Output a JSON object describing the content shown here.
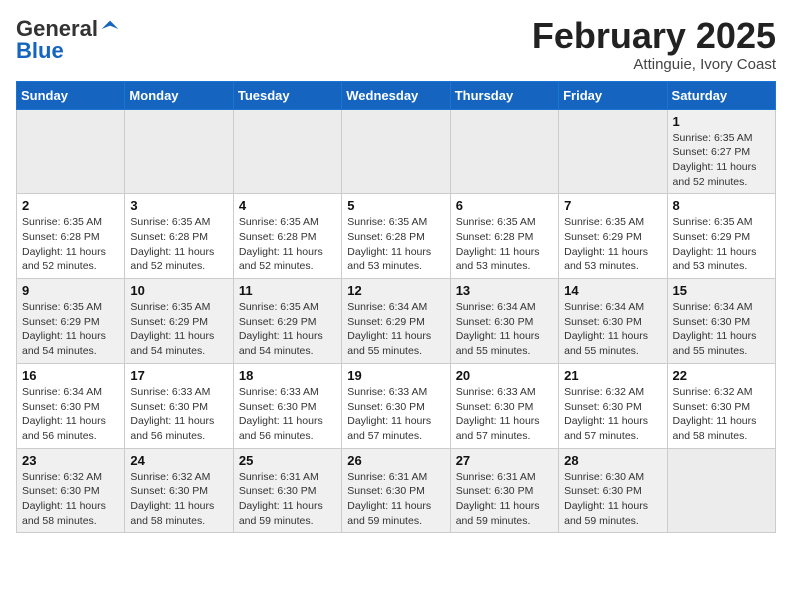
{
  "logo": {
    "general": "General",
    "blue": "Blue"
  },
  "header": {
    "month": "February 2025",
    "location": "Attinguie, Ivory Coast"
  },
  "weekdays": [
    "Sunday",
    "Monday",
    "Tuesday",
    "Wednesday",
    "Thursday",
    "Friday",
    "Saturday"
  ],
  "weeks": [
    [
      {
        "day": "",
        "info": ""
      },
      {
        "day": "",
        "info": ""
      },
      {
        "day": "",
        "info": ""
      },
      {
        "day": "",
        "info": ""
      },
      {
        "day": "",
        "info": ""
      },
      {
        "day": "",
        "info": ""
      },
      {
        "day": "1",
        "info": "Sunrise: 6:35 AM\nSunset: 6:27 PM\nDaylight: 11 hours and 52 minutes."
      }
    ],
    [
      {
        "day": "2",
        "info": "Sunrise: 6:35 AM\nSunset: 6:28 PM\nDaylight: 11 hours and 52 minutes."
      },
      {
        "day": "3",
        "info": "Sunrise: 6:35 AM\nSunset: 6:28 PM\nDaylight: 11 hours and 52 minutes."
      },
      {
        "day": "4",
        "info": "Sunrise: 6:35 AM\nSunset: 6:28 PM\nDaylight: 11 hours and 52 minutes."
      },
      {
        "day": "5",
        "info": "Sunrise: 6:35 AM\nSunset: 6:28 PM\nDaylight: 11 hours and 53 minutes."
      },
      {
        "day": "6",
        "info": "Sunrise: 6:35 AM\nSunset: 6:28 PM\nDaylight: 11 hours and 53 minutes."
      },
      {
        "day": "7",
        "info": "Sunrise: 6:35 AM\nSunset: 6:29 PM\nDaylight: 11 hours and 53 minutes."
      },
      {
        "day": "8",
        "info": "Sunrise: 6:35 AM\nSunset: 6:29 PM\nDaylight: 11 hours and 53 minutes."
      }
    ],
    [
      {
        "day": "9",
        "info": "Sunrise: 6:35 AM\nSunset: 6:29 PM\nDaylight: 11 hours and 54 minutes."
      },
      {
        "day": "10",
        "info": "Sunrise: 6:35 AM\nSunset: 6:29 PM\nDaylight: 11 hours and 54 minutes."
      },
      {
        "day": "11",
        "info": "Sunrise: 6:35 AM\nSunset: 6:29 PM\nDaylight: 11 hours and 54 minutes."
      },
      {
        "day": "12",
        "info": "Sunrise: 6:34 AM\nSunset: 6:29 PM\nDaylight: 11 hours and 55 minutes."
      },
      {
        "day": "13",
        "info": "Sunrise: 6:34 AM\nSunset: 6:30 PM\nDaylight: 11 hours and 55 minutes."
      },
      {
        "day": "14",
        "info": "Sunrise: 6:34 AM\nSunset: 6:30 PM\nDaylight: 11 hours and 55 minutes."
      },
      {
        "day": "15",
        "info": "Sunrise: 6:34 AM\nSunset: 6:30 PM\nDaylight: 11 hours and 55 minutes."
      }
    ],
    [
      {
        "day": "16",
        "info": "Sunrise: 6:34 AM\nSunset: 6:30 PM\nDaylight: 11 hours and 56 minutes."
      },
      {
        "day": "17",
        "info": "Sunrise: 6:33 AM\nSunset: 6:30 PM\nDaylight: 11 hours and 56 minutes."
      },
      {
        "day": "18",
        "info": "Sunrise: 6:33 AM\nSunset: 6:30 PM\nDaylight: 11 hours and 56 minutes."
      },
      {
        "day": "19",
        "info": "Sunrise: 6:33 AM\nSunset: 6:30 PM\nDaylight: 11 hours and 57 minutes."
      },
      {
        "day": "20",
        "info": "Sunrise: 6:33 AM\nSunset: 6:30 PM\nDaylight: 11 hours and 57 minutes."
      },
      {
        "day": "21",
        "info": "Sunrise: 6:32 AM\nSunset: 6:30 PM\nDaylight: 11 hours and 57 minutes."
      },
      {
        "day": "22",
        "info": "Sunrise: 6:32 AM\nSunset: 6:30 PM\nDaylight: 11 hours and 58 minutes."
      }
    ],
    [
      {
        "day": "23",
        "info": "Sunrise: 6:32 AM\nSunset: 6:30 PM\nDaylight: 11 hours and 58 minutes."
      },
      {
        "day": "24",
        "info": "Sunrise: 6:32 AM\nSunset: 6:30 PM\nDaylight: 11 hours and 58 minutes."
      },
      {
        "day": "25",
        "info": "Sunrise: 6:31 AM\nSunset: 6:30 PM\nDaylight: 11 hours and 59 minutes."
      },
      {
        "day": "26",
        "info": "Sunrise: 6:31 AM\nSunset: 6:30 PM\nDaylight: 11 hours and 59 minutes."
      },
      {
        "day": "27",
        "info": "Sunrise: 6:31 AM\nSunset: 6:30 PM\nDaylight: 11 hours and 59 minutes."
      },
      {
        "day": "28",
        "info": "Sunrise: 6:30 AM\nSunset: 6:30 PM\nDaylight: 11 hours and 59 minutes."
      },
      {
        "day": "",
        "info": ""
      }
    ]
  ]
}
